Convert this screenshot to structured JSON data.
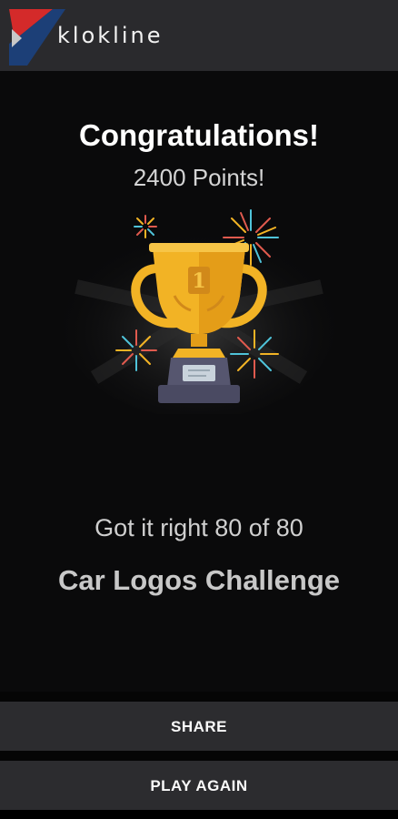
{
  "app_bar": {
    "brand": "klokline",
    "icon": "klokline-logo-icon"
  },
  "result": {
    "title": "Congratulations!",
    "points": "2400 Points!",
    "score_text": "Got it right 80 of 80",
    "quiz_name": "Car Logos Challenge",
    "trophy_icon": "trophy-icon",
    "trophy_rank": "1"
  },
  "actions": {
    "share_label": "SHARE",
    "play_again_label": "PLAY AGAIN"
  },
  "colors": {
    "app_bar": "#2a2a2d",
    "background": "#0a0a0b",
    "trophy_gold": "#f2b325",
    "trophy_base": "#4f4f6b",
    "logo_red": "#d42a2a",
    "logo_blue": "#1c3f77"
  }
}
